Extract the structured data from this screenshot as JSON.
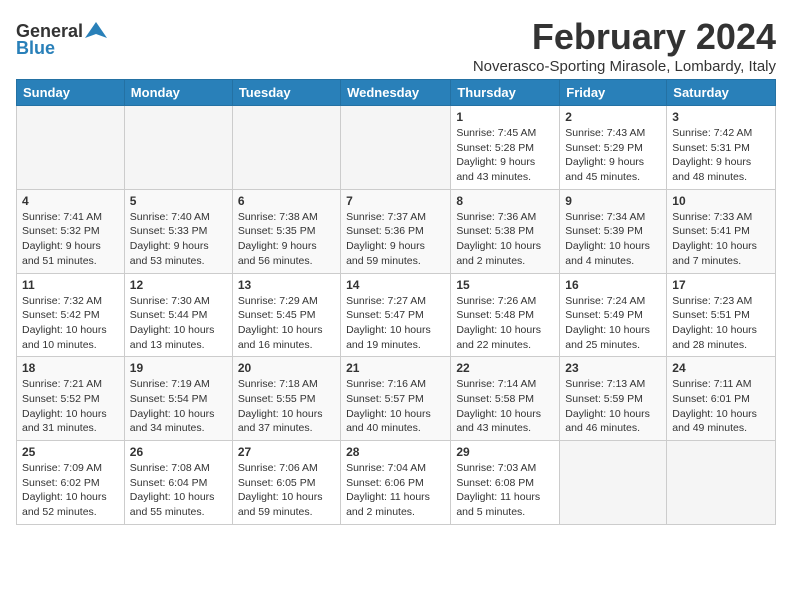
{
  "header": {
    "logo_general": "General",
    "logo_blue": "Blue",
    "month": "February 2024",
    "location": "Noverasco-Sporting Mirasole, Lombardy, Italy"
  },
  "days_of_week": [
    "Sunday",
    "Monday",
    "Tuesday",
    "Wednesday",
    "Thursday",
    "Friday",
    "Saturday"
  ],
  "weeks": [
    [
      {
        "day": "",
        "content": ""
      },
      {
        "day": "",
        "content": ""
      },
      {
        "day": "",
        "content": ""
      },
      {
        "day": "",
        "content": ""
      },
      {
        "day": "1",
        "content": "Sunrise: 7:45 AM\nSunset: 5:28 PM\nDaylight: 9 hours\nand 43 minutes."
      },
      {
        "day": "2",
        "content": "Sunrise: 7:43 AM\nSunset: 5:29 PM\nDaylight: 9 hours\nand 45 minutes."
      },
      {
        "day": "3",
        "content": "Sunrise: 7:42 AM\nSunset: 5:31 PM\nDaylight: 9 hours\nand 48 minutes."
      }
    ],
    [
      {
        "day": "4",
        "content": "Sunrise: 7:41 AM\nSunset: 5:32 PM\nDaylight: 9 hours\nand 51 minutes."
      },
      {
        "day": "5",
        "content": "Sunrise: 7:40 AM\nSunset: 5:33 PM\nDaylight: 9 hours\nand 53 minutes."
      },
      {
        "day": "6",
        "content": "Sunrise: 7:38 AM\nSunset: 5:35 PM\nDaylight: 9 hours\nand 56 minutes."
      },
      {
        "day": "7",
        "content": "Sunrise: 7:37 AM\nSunset: 5:36 PM\nDaylight: 9 hours\nand 59 minutes."
      },
      {
        "day": "8",
        "content": "Sunrise: 7:36 AM\nSunset: 5:38 PM\nDaylight: 10 hours\nand 2 minutes."
      },
      {
        "day": "9",
        "content": "Sunrise: 7:34 AM\nSunset: 5:39 PM\nDaylight: 10 hours\nand 4 minutes."
      },
      {
        "day": "10",
        "content": "Sunrise: 7:33 AM\nSunset: 5:41 PM\nDaylight: 10 hours\nand 7 minutes."
      }
    ],
    [
      {
        "day": "11",
        "content": "Sunrise: 7:32 AM\nSunset: 5:42 PM\nDaylight: 10 hours\nand 10 minutes."
      },
      {
        "day": "12",
        "content": "Sunrise: 7:30 AM\nSunset: 5:44 PM\nDaylight: 10 hours\nand 13 minutes."
      },
      {
        "day": "13",
        "content": "Sunrise: 7:29 AM\nSunset: 5:45 PM\nDaylight: 10 hours\nand 16 minutes."
      },
      {
        "day": "14",
        "content": "Sunrise: 7:27 AM\nSunset: 5:47 PM\nDaylight: 10 hours\nand 19 minutes."
      },
      {
        "day": "15",
        "content": "Sunrise: 7:26 AM\nSunset: 5:48 PM\nDaylight: 10 hours\nand 22 minutes."
      },
      {
        "day": "16",
        "content": "Sunrise: 7:24 AM\nSunset: 5:49 PM\nDaylight: 10 hours\nand 25 minutes."
      },
      {
        "day": "17",
        "content": "Sunrise: 7:23 AM\nSunset: 5:51 PM\nDaylight: 10 hours\nand 28 minutes."
      }
    ],
    [
      {
        "day": "18",
        "content": "Sunrise: 7:21 AM\nSunset: 5:52 PM\nDaylight: 10 hours\nand 31 minutes."
      },
      {
        "day": "19",
        "content": "Sunrise: 7:19 AM\nSunset: 5:54 PM\nDaylight: 10 hours\nand 34 minutes."
      },
      {
        "day": "20",
        "content": "Sunrise: 7:18 AM\nSunset: 5:55 PM\nDaylight: 10 hours\nand 37 minutes."
      },
      {
        "day": "21",
        "content": "Sunrise: 7:16 AM\nSunset: 5:57 PM\nDaylight: 10 hours\nand 40 minutes."
      },
      {
        "day": "22",
        "content": "Sunrise: 7:14 AM\nSunset: 5:58 PM\nDaylight: 10 hours\nand 43 minutes."
      },
      {
        "day": "23",
        "content": "Sunrise: 7:13 AM\nSunset: 5:59 PM\nDaylight: 10 hours\nand 46 minutes."
      },
      {
        "day": "24",
        "content": "Sunrise: 7:11 AM\nSunset: 6:01 PM\nDaylight: 10 hours\nand 49 minutes."
      }
    ],
    [
      {
        "day": "25",
        "content": "Sunrise: 7:09 AM\nSunset: 6:02 PM\nDaylight: 10 hours\nand 52 minutes."
      },
      {
        "day": "26",
        "content": "Sunrise: 7:08 AM\nSunset: 6:04 PM\nDaylight: 10 hours\nand 55 minutes."
      },
      {
        "day": "27",
        "content": "Sunrise: 7:06 AM\nSunset: 6:05 PM\nDaylight: 10 hours\nand 59 minutes."
      },
      {
        "day": "28",
        "content": "Sunrise: 7:04 AM\nSunset: 6:06 PM\nDaylight: 11 hours\nand 2 minutes."
      },
      {
        "day": "29",
        "content": "Sunrise: 7:03 AM\nSunset: 6:08 PM\nDaylight: 11 hours\nand 5 minutes."
      },
      {
        "day": "",
        "content": ""
      },
      {
        "day": "",
        "content": ""
      }
    ]
  ]
}
